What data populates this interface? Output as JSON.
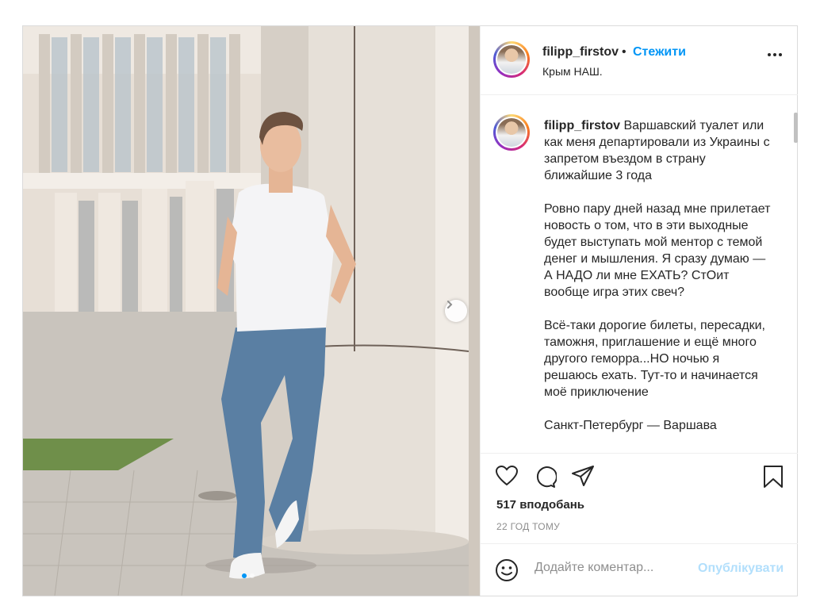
{
  "post": {
    "username": "filipp_firstov",
    "separator": "•",
    "follow_label": "Стежити",
    "location": "Крым НАШ.",
    "caption_paragraphs": [
      "Варшавский туалет или как меня департировали из Украины с запретом въездом в страну ближайшие 3 года",
      "Ровно пару дней назад мне прилетает новость о том, что в эти выходные будет выступать мой ментор с темой денег и мышления. Я сразу думаю — А НАДО ли мне ЕХАТЬ? СтОит вообще игра этих свеч?",
      "Всё-таки дорогие билеты, пересадки, таможня, приглашение и ещё много другого геморра...НО ночью я решаюсь ехать. Тут-то и начинается моё приключение",
      "Санкт-Петербург — Варшава"
    ],
    "likes": "517 вподобань",
    "time_ago": "22 ГОД ТОМУ",
    "comment_placeholder": "Додайте коментар...",
    "publish_label": "Опублікувати",
    "carousel": {
      "slides": 2,
      "active_index": 0
    },
    "icons": [
      "more-icon",
      "heart-icon",
      "comment-icon",
      "share-icon",
      "bookmark-icon",
      "emoji-icon",
      "chevron-right-icon"
    ],
    "colors": {
      "accent": "#0095f6",
      "publish_disabled": "#b2dffc",
      "muted": "#8e8e8e"
    }
  }
}
